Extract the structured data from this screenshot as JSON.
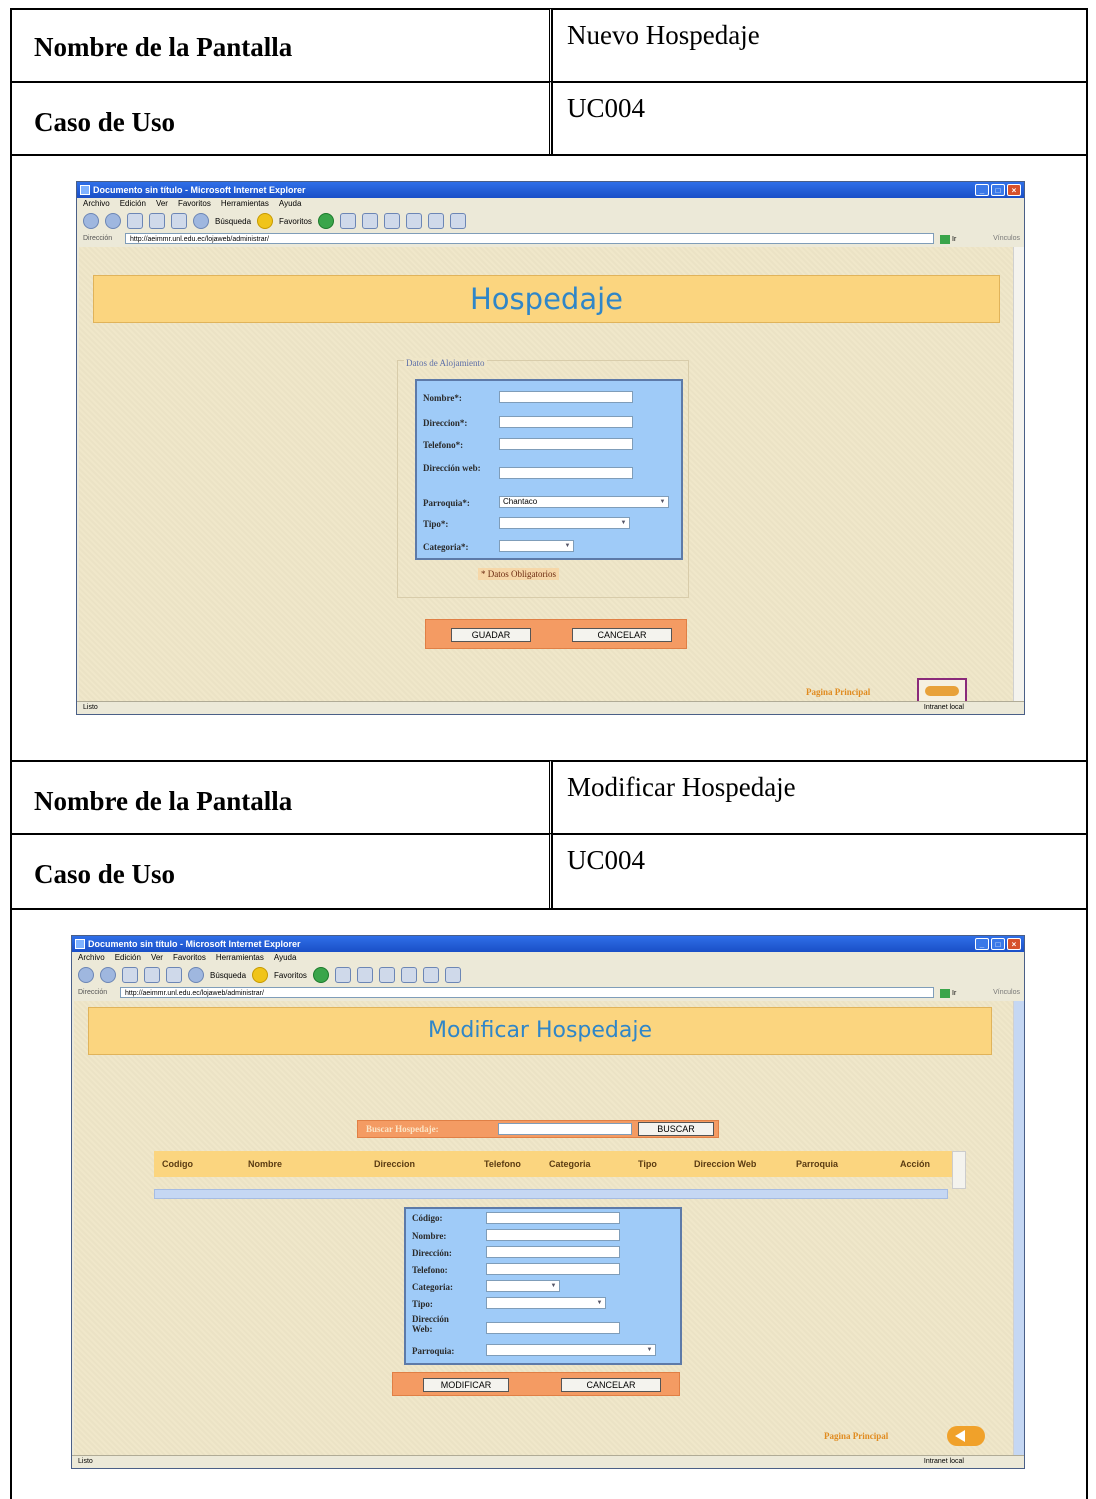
{
  "sections": [
    {
      "screen_label": "Nombre de la Pantalla",
      "screen_value": "Nuevo Hospedaje",
      "usecase_label": "Caso de Uso",
      "usecase_value": "UC004"
    },
    {
      "screen_label": "Nombre de la Pantalla",
      "screen_value": "Modificar Hospedaje",
      "usecase_label": "Caso de Uso",
      "usecase_value": "UC004"
    }
  ],
  "browser": {
    "title": "Documento sin título - Microsoft Internet Explorer",
    "menu": [
      "Archivo",
      "Edición",
      "Ver",
      "Favoritos",
      "Herramientas",
      "Ayuda"
    ],
    "toolbar": {
      "search": "Búsqueda",
      "favorites": "Favoritos"
    },
    "address_label": "Dirección",
    "address_url": "http://aeimmr.unl.edu.ec/lojaweb/administrar/",
    "go_label": "Ir",
    "links_label": "Vínculos",
    "status_left": "Listo",
    "status_right": "Intranet local"
  },
  "screen1": {
    "banner": "Hospedaje",
    "fieldset_legend": "Datos de Alojamiento",
    "fields": [
      {
        "label": "Nombre*:",
        "value": ""
      },
      {
        "label": "Direccion*:",
        "value": ""
      },
      {
        "label": "Telefono*:",
        "value": ""
      },
      {
        "label": "Dirección web:",
        "value": ""
      },
      {
        "label": "Parroquia*:",
        "value": "Chantaco"
      },
      {
        "label": "Tipo*:",
        "value": ""
      },
      {
        "label": "Categoria*:",
        "value": ""
      }
    ],
    "required_note": "* Datos Obligatorios",
    "save_button": "GUADAR",
    "cancel_button": "CANCELAR",
    "home_link": "Pagina Principal"
  },
  "screen2": {
    "banner": "Modificar Hospedaje",
    "search_label": "Buscar Hospedaje:",
    "search_value": "",
    "search_button": "BUSCAR",
    "table_headers": [
      "Codigo",
      "Nombre",
      "Direccion",
      "Telefono",
      "Categoria",
      "Tipo",
      "Direccion Web",
      "Parroquia",
      "Acción"
    ],
    "fields": [
      {
        "label": "Código:",
        "value": ""
      },
      {
        "label": "Nombre:",
        "value": ""
      },
      {
        "label": "Dirección:",
        "value": ""
      },
      {
        "label": "Telefono:",
        "value": ""
      },
      {
        "label": "Categoria:",
        "value": ""
      },
      {
        "label": "Tipo:",
        "value": ""
      },
      {
        "label": "Dirección Web:",
        "value": ""
      },
      {
        "label": "Parroquia:",
        "value": ""
      }
    ],
    "modify_button": "MODIFICAR",
    "cancel_button": "CANCELAR",
    "home_link": "Pagina Principal"
  }
}
